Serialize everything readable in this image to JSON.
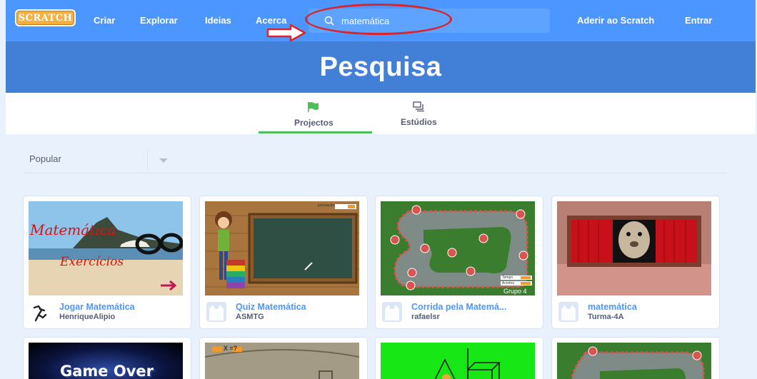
{
  "nav": {
    "logo_text": "SCRATCH",
    "links": [
      "Criar",
      "Explorar",
      "Ideias",
      "Acerca"
    ],
    "search_value": "matemática",
    "join": "Aderir ao Scratch",
    "signin": "Entrar"
  },
  "banner": {
    "title": "Pesquisa"
  },
  "tabs": {
    "projects": "Projectos",
    "studios": "Estúdios"
  },
  "sort": {
    "selected": "Popular"
  },
  "projects": [
    {
      "title": "Jogar Matemática",
      "author": "HenriqueAlipio",
      "thumb_text": "Matemática",
      "thumb_text2": "Exercícios"
    },
    {
      "title": "Quiz Matemática",
      "author": "ASMTG",
      "thumb_text": "pontuação"
    },
    {
      "title": "Corrida pela Matemá...",
      "author": "rafaelsr",
      "thumb_text": "Grupo 4",
      "thumb_labels": [
        "Tempo",
        "Acertos"
      ]
    },
    {
      "title": "matemática",
      "author": "Turma-4A"
    }
  ],
  "row2": [
    {
      "thumb_text": "Game Over"
    },
    {
      "thumb_text": "X =?"
    },
    {
      "thumb_text": ""
    },
    {
      "thumb_text": ""
    }
  ],
  "colors": {
    "nav": "#4c97ff",
    "banner": "#4280d7",
    "accent_green": "#4cbf56",
    "annotation_red": "#d7262e"
  }
}
